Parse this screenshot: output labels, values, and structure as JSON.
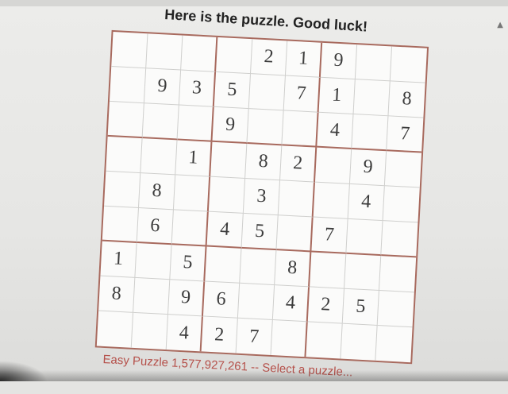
{
  "header": {
    "title": "Here is the puzzle. Good luck!"
  },
  "grid": {
    "rows": [
      [
        "",
        "",
        "",
        "",
        "2",
        "1",
        "9",
        "",
        ""
      ],
      [
        "",
        "9",
        "3",
        "5",
        "",
        "7",
        "1",
        "",
        "8"
      ],
      [
        "",
        "",
        "",
        "9",
        "",
        "",
        "4",
        "",
        "7"
      ],
      [
        "",
        "",
        "1",
        "",
        "8",
        "2",
        "",
        "9",
        ""
      ],
      [
        "",
        "8",
        "",
        "",
        "3",
        "",
        "",
        "4",
        ""
      ],
      [
        "",
        "6",
        "",
        "4",
        "5",
        "",
        "7",
        "",
        ""
      ],
      [
        "1",
        "",
        "5",
        "",
        "",
        "8",
        "",
        "",
        ""
      ],
      [
        "8",
        "",
        "9",
        "6",
        "",
        "4",
        "2",
        "5",
        ""
      ],
      [
        "",
        "",
        "4",
        "2",
        "7",
        "",
        "",
        "",
        ""
      ]
    ]
  },
  "footer": {
    "link_text": "Easy Puzzle 1,577,927,261 -- Select a puzzle..."
  },
  "colors": {
    "grid_border": "#a86a5e",
    "link": "#b5504a"
  },
  "icons": {
    "scroll_arrow": "chevron-up-icon"
  }
}
